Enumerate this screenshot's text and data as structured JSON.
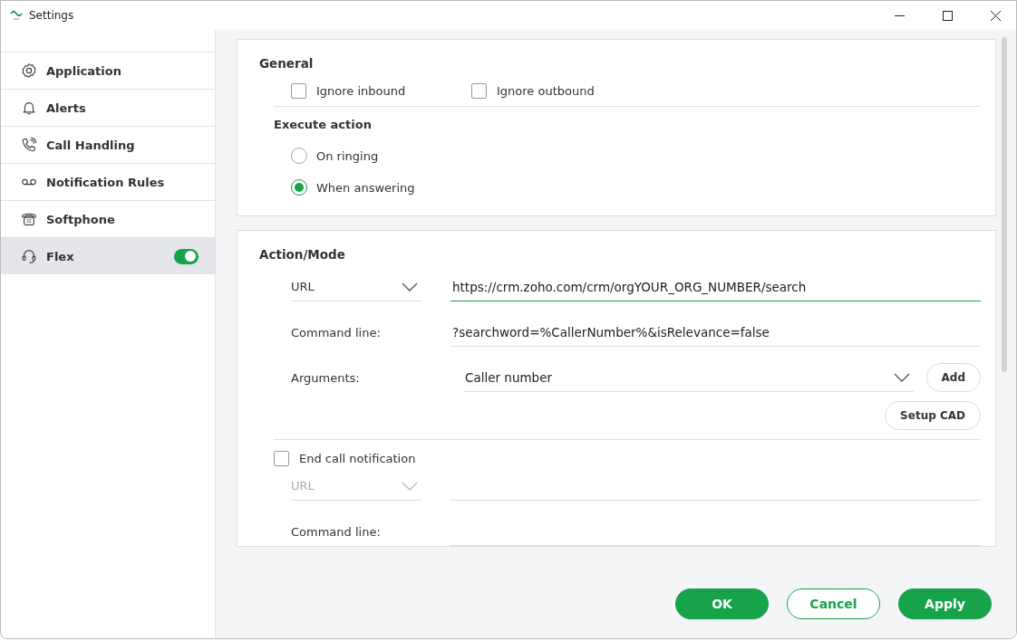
{
  "window": {
    "title": "Settings"
  },
  "sidebar": {
    "items": [
      {
        "label": "Application",
        "selected": false
      },
      {
        "label": "Alerts",
        "selected": false
      },
      {
        "label": "Call Handling",
        "selected": false
      },
      {
        "label": "Notification Rules",
        "selected": false
      },
      {
        "label": "Softphone",
        "selected": false
      },
      {
        "label": "Flex",
        "selected": true,
        "toggle_on": true
      }
    ]
  },
  "general": {
    "title": "General",
    "checkboxes": [
      {
        "label": "Ignore inbound",
        "checked": false
      },
      {
        "label": "Ignore outbound",
        "checked": false
      }
    ],
    "execute_action": {
      "title": "Execute action",
      "options": [
        {
          "label": "On ringing",
          "selected": false
        },
        {
          "label": "When answering",
          "selected": true
        }
      ]
    }
  },
  "action_mode": {
    "title": "Action/Mode",
    "type_select": {
      "value": "URL",
      "disabled": false
    },
    "url_field": {
      "value": "https://crm.zoho.com/crm/orgYOUR_ORG_NUMBER/search",
      "focused": true
    },
    "command_line": {
      "label": "Command line:",
      "value": "?searchword=%CallerNumber%&isRelevance=false"
    },
    "arguments": {
      "label": "Arguments:",
      "value": "Caller number"
    },
    "add_button": "Add",
    "setup_cad_button": "Setup CAD",
    "end_call": {
      "label": "End call notification",
      "checked": false,
      "type_select": {
        "value": "URL",
        "disabled": true
      },
      "command_line": {
        "label": "Command line:"
      }
    }
  },
  "footer": {
    "buttons": [
      {
        "label": "OK",
        "kind": "primary"
      },
      {
        "label": "Cancel",
        "kind": "outline"
      },
      {
        "label": "Apply",
        "kind": "primary"
      }
    ]
  }
}
